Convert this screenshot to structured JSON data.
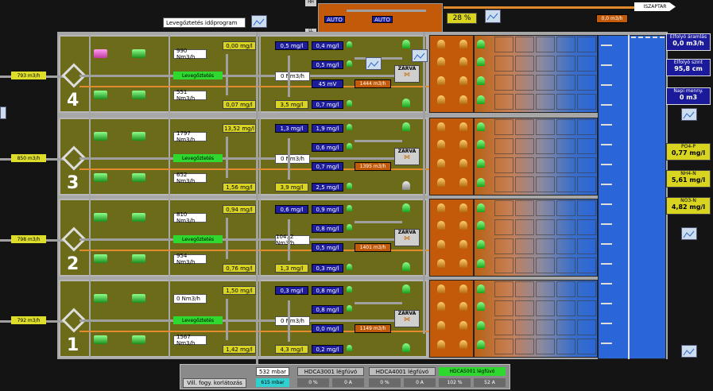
{
  "header": {
    "schedule_label": "Levegőztetés időprogram",
    "hh_label": "HH",
    "ll_label": "LL",
    "auto1": "AUTO",
    "auto2": "AUTO",
    "pct": "28 %",
    "flow_top": "0,0 m3/h",
    "outlet": "ISZAPTAR"
  },
  "lines": [
    {
      "num": "4",
      "air_in": "793 m3/h",
      "o2_top": "0,00 mg/l",
      "flow1": "990 Nm3/h",
      "aer": "Levegőztetés",
      "flow2": "551 Nm3/h",
      "o2_bot": "0,07 mg/l",
      "total": "0 Nm3/h",
      "b1": "0,5 mg/l",
      "b2": "0,4 mg/l",
      "b3": "0,5 mg/l",
      "mv": "45 mV",
      "ret": "1444 m3/h",
      "b4": "3,5 mg/l",
      "b5": "0,7 mg/l",
      "valve": "ZÁRVA"
    },
    {
      "num": "3",
      "air_in": "850 m3/h",
      "o2_top": "13,52 mg/l",
      "flow1": "1797 Nm3/h",
      "aer": "Levegőztetés",
      "flow2": "652 Nm3/h",
      "o2_bot": "1,56 mg/l",
      "total": "0 Nm3/h",
      "b1": "1,3 mg/l",
      "b2": "1,9 mg/l",
      "b3": "0,6 mg/l",
      "b3b": "0,7 mg/l",
      "ret": "1395 m3/h",
      "b4": "3,9 mg/l",
      "b5": "2,5 mg/l",
      "valve": "ZÁRVA"
    },
    {
      "num": "2",
      "air_in": "798 m3/h",
      "o2_top": "0,94 mg/l",
      "flow1": "810 Nm3/h",
      "aer": "Levegőztetés",
      "flow2": "954 Nm3/h",
      "o2_bot": "0,76 mg/l",
      "total": "10412 Nm3/h",
      "b1": "0,6 mg/l",
      "b2": "0,9 mg/l",
      "b3": "0,8 mg/l",
      "b3b": "0,5 mg/l",
      "ret": "1401 m3/h",
      "b4": "1,3 mg/l",
      "b5": "0,3 mg/l",
      "valve": "ZÁRVA"
    },
    {
      "num": "1",
      "air_in": "792 m3/h",
      "o2_top": "1,50 mg/l",
      "flow1": "0 Nm3/h",
      "aer": "Levegőztetés",
      "flow2": "1567 Nm3/h",
      "o2_bot": "1,42 mg/l",
      "total": "0 Nm3/h",
      "b1": "0,3 mg/l",
      "b2": "0,8 mg/l",
      "b3": "0,8 mg/l",
      "b3b": "0,0 mg/l",
      "ret": "1149 m3/h",
      "b4": "4,3 mg/l",
      "b5": "0,2 mg/l",
      "valve": "ZÁRVA"
    }
  ],
  "side": {
    "efflow_label": "Elfolyó áramlás",
    "efflow": "0,0 m3/h",
    "level_label": "Elfolyó szint",
    "level": "95,8 cm",
    "daily_label": "Napi menny.",
    "daily": "0 m3",
    "po4_label": "PO4-P",
    "po4": "0,77 mg/l",
    "nh4_label": "NH4-N",
    "nh4": "5,61 mg/l",
    "no3_label": "NO3-N",
    "no3": "4,82 mg/l"
  },
  "footer": {
    "power_label": "Vill. fogy. korlátozás",
    "mbar1": "532 mbar",
    "mbar2": "615 mbar",
    "b1": "HDCA3001 légfúvó",
    "b2": "HDCA4001 légfúvó",
    "b3": "HDCA5001 légfúvó",
    "b1v1": "0 %",
    "b1v2": "0 A",
    "b2v1": "0 %",
    "b2v2": "0 A",
    "b3v1": "102 %",
    "b3v2": "52 A"
  },
  "colors": {
    "basin": "#6b6b1a",
    "blue_tank": "#2a66d8",
    "orange": "#c25a0a",
    "green": "#2fd82f",
    "yellow": "#d8d420"
  }
}
